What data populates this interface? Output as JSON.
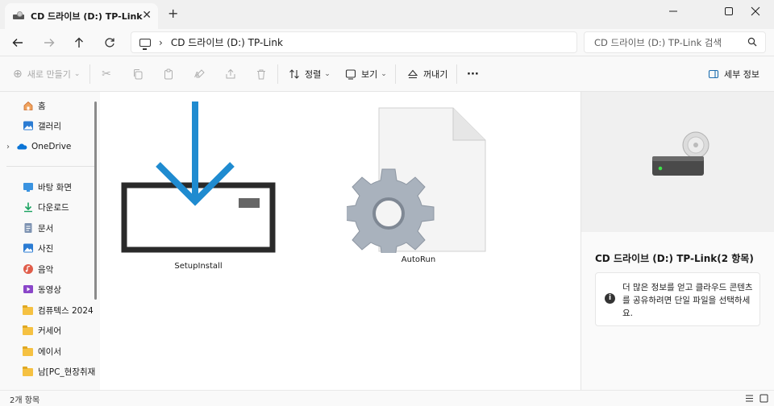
{
  "tab": {
    "title": "CD 드라이브 (D:) TP-Link"
  },
  "address": {
    "path": "CD 드라이브 (D:) TP-Link"
  },
  "search": {
    "placeholder": "CD 드라이브 (D:) TP-Link 검색"
  },
  "commands": {
    "new_label": "새로 만들기",
    "sort_label": "정렬",
    "view_label": "보기",
    "eject_label": "꺼내기",
    "more_label": "···",
    "details_label": "세부 정보"
  },
  "sidebar": {
    "items": [
      {
        "label": "홈",
        "icon": "home-icon"
      },
      {
        "label": "갤러리",
        "icon": "gallery-icon"
      },
      {
        "label": "OneDrive",
        "icon": "onedrive-icon"
      },
      {
        "label": "바탕 화면",
        "icon": "desktop-icon"
      },
      {
        "label": "다운로드",
        "icon": "download-icon"
      },
      {
        "label": "문서",
        "icon": "documents-icon"
      },
      {
        "label": "사진",
        "icon": "pictures-icon"
      },
      {
        "label": "음악",
        "icon": "music-icon"
      },
      {
        "label": "동영상",
        "icon": "videos-icon"
      },
      {
        "label": "컴퓨텍스 2024",
        "icon": "folder-icon"
      },
      {
        "label": "커세어",
        "icon": "folder-icon"
      },
      {
        "label": "에이서",
        "icon": "folder-icon"
      },
      {
        "label": "남[PC_현장취재",
        "icon": "folder-icon"
      }
    ]
  },
  "files": [
    {
      "name": "SetupInstall",
      "icon": "installer-icon"
    },
    {
      "name": "AutoRun",
      "icon": "settings-file-icon"
    }
  ],
  "details": {
    "title": "CD 드라이브 (D:) TP-Link(2 항목)",
    "info": "더 많은 정보를 얻고 클라우드 콘텐츠를 공유하려면 단일 파일을 선택하세요."
  },
  "status": {
    "count": "2개 항목"
  },
  "colors": {
    "accent": "#1f8bd0",
    "folder": "#f5c142"
  }
}
